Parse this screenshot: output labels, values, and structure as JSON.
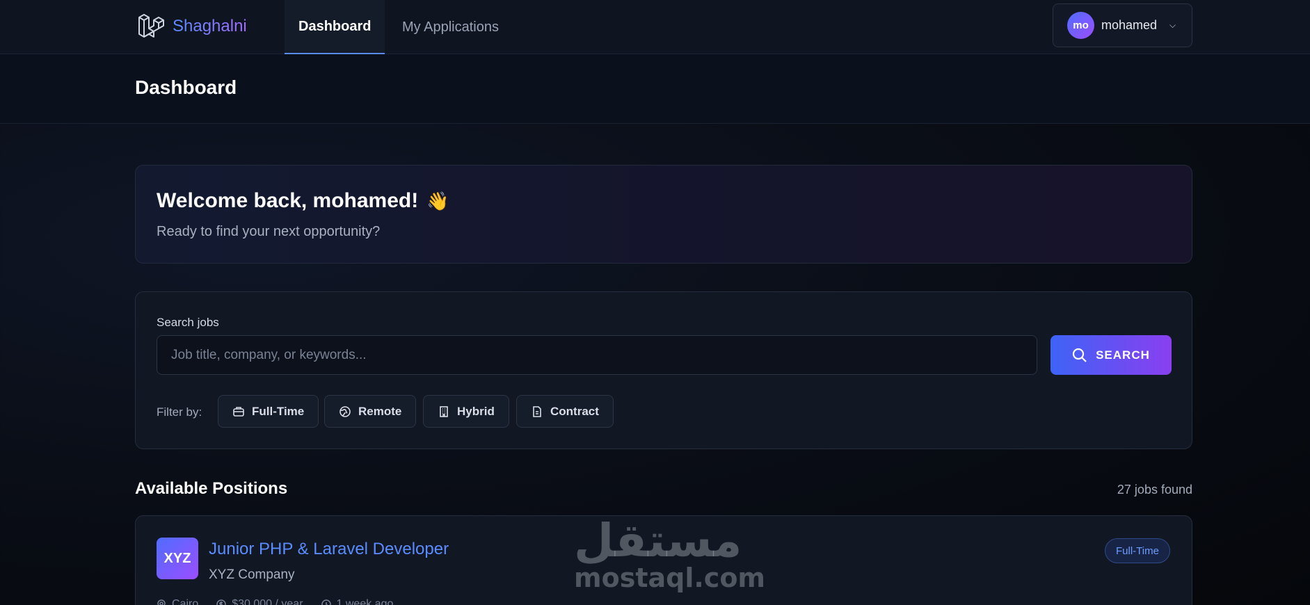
{
  "nav": {
    "logo_text": "Shaghalni",
    "tabs": [
      {
        "label": "Dashboard",
        "active": true
      },
      {
        "label": "My Applications",
        "active": false
      }
    ],
    "user": {
      "initials": "mo",
      "name": "mohamed"
    }
  },
  "header": {
    "title": "Dashboard"
  },
  "welcome": {
    "title": "Welcome back, mohamed!",
    "emoji": "👋",
    "subtitle": "Ready to find your next opportunity?"
  },
  "search": {
    "label": "Search jobs",
    "placeholder": "Job title, company, or keywords...",
    "value": "",
    "button_label": "SEARCH",
    "filter_label": "Filter by:",
    "filters": [
      "Full-Time",
      "Remote",
      "Hybrid",
      "Contract"
    ]
  },
  "positions": {
    "title": "Available Positions",
    "count_text": "27 jobs found",
    "jobs": [
      {
        "logo": "XYZ",
        "title": "Junior PHP & Laravel Developer",
        "company": "XYZ Company",
        "location": "Cairo",
        "salary": "$30,000 / year",
        "posted": "1 week ago",
        "type": "Full-Time"
      }
    ]
  },
  "watermark": {
    "arabic": "مستقل",
    "latin": "mostaql.com"
  },
  "colors": {
    "accent": "#5b8cff",
    "gradient_start": "#3e63f6",
    "gradient_end": "#8a3ff0",
    "background": "#0a0e17"
  }
}
